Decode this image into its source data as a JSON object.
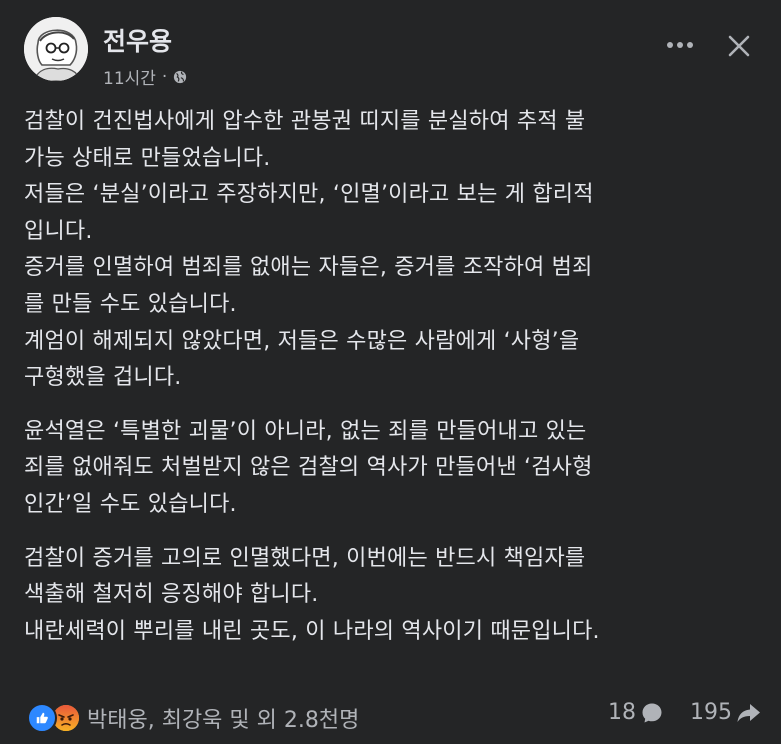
{
  "post": {
    "author": "전우용",
    "time": "11시간",
    "separator": "·",
    "privacy_icon": "globe-icon",
    "paragraphs": [
      {
        "lines": [
          "검찰이 건진법사에게 압수한 관봉권 띠지를 분실하여 추적 불",
          "가능 상태로 만들었습니다.",
          "저들은 ‘분실’이라고 주장하지만, ‘인멸’이라고 보는 게 합리적",
          "입니다.",
          "증거를 인멸하여 범죄를 없애는 자들은, 증거를 조작하여 범죄",
          "를 만들 수도 있습니다.",
          "계엄이 해제되지 않았다면, 저들은 수많은 사람에게 ‘사형’을",
          "구형했을 겁니다."
        ]
      },
      {
        "lines": [
          "윤석열은 ‘특별한 괴물’이 아니라, 없는 죄를 만들어내고 있는",
          "죄를 없애줘도 처벌받지 않은 검찰의 역사가 만들어낸 ‘검사형",
          "인간’일 수도 있습니다."
        ]
      },
      {
        "lines": [
          "검찰이 증거를 고의로 인멸했다면, 이번에는 반드시 책임자를",
          "색출해 철저히 응징해야 합니다.",
          "내란세력이 뿌리를 내린 곳도, 이 나라의 역사이기 때문입니다."
        ]
      }
    ]
  },
  "footer": {
    "reactions_text": "박태웅, 최강욱 및 외 2.8천명",
    "comment_count": "18",
    "share_count": "195"
  },
  "colors": {
    "background": "#242526",
    "text": "#e4e6eb",
    "secondary": "#b0b3b8",
    "like": "#2d88ff",
    "angry": "#f7b125"
  }
}
